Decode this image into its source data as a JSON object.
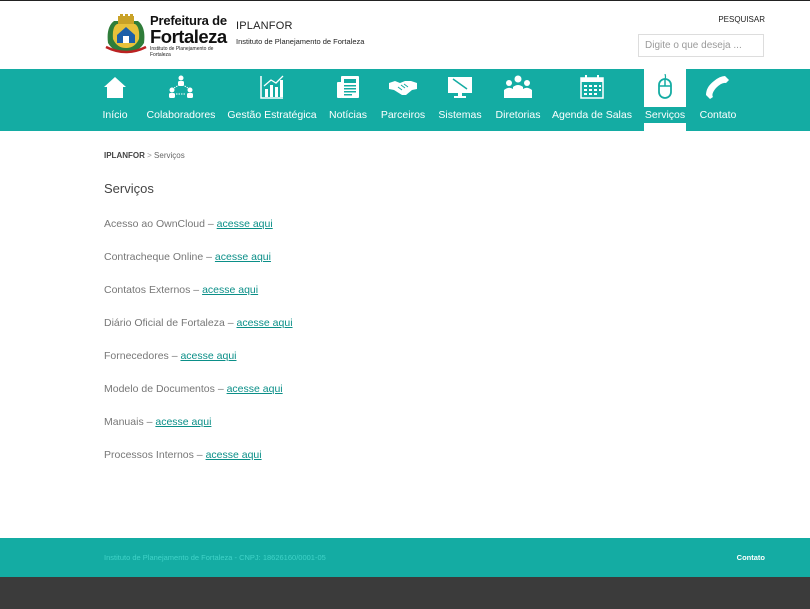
{
  "header": {
    "logo": {
      "line1": "Prefeitura de",
      "line2": "Fortaleza",
      "line3": "Instituto de Planejamento de Fortaleza"
    },
    "org_name": "IPLANFOR",
    "org_subtitle": "Instituto de Planejamento de Fortaleza",
    "search_label": "PESQUISAR",
    "search_placeholder": "Digite o que deseja ..."
  },
  "nav": {
    "items": [
      {
        "label": "Início",
        "icon": "home-icon"
      },
      {
        "label": "Colaboradores",
        "icon": "network-icon"
      },
      {
        "label": "Gestão Estratégica",
        "icon": "chart-icon"
      },
      {
        "label": "Notícias",
        "icon": "newspaper-icon"
      },
      {
        "label": "Parceiros",
        "icon": "handshake-icon"
      },
      {
        "label": "Sistemas",
        "icon": "monitor-icon"
      },
      {
        "label": "Diretorias",
        "icon": "group-icon"
      },
      {
        "label": "Agenda de Salas",
        "icon": "calendar-icon"
      },
      {
        "label": "Serviços",
        "icon": "mouse-icon",
        "active": true
      },
      {
        "label": "Contato",
        "icon": "phone-icon"
      }
    ]
  },
  "breadcrumb": {
    "home": "IPLANFOR",
    "separator": ">",
    "current": "Serviços"
  },
  "page_title": "Serviços",
  "services": {
    "link_label": "acesse aqui",
    "items": [
      {
        "prefix": "Acesso ao OwnCloud –"
      },
      {
        "prefix": "Contracheque Online –"
      },
      {
        "prefix": "Contatos Externos –"
      },
      {
        "prefix": "Diário Oficial de Fortaleza –"
      },
      {
        "prefix": "Fornecedores –"
      },
      {
        "prefix": "Modelo de Documentos –"
      },
      {
        "prefix": "Manuais –"
      },
      {
        "prefix": "Processos Internos –"
      }
    ]
  },
  "footer": {
    "left": "Instituto de Planejamento de Fortaleza - CNPJ: 18626160/0001-05",
    "right": "Contato"
  },
  "colors": {
    "accent": "#14aca3",
    "link": "#0b8f88",
    "bottom": "#3b3b3b"
  }
}
